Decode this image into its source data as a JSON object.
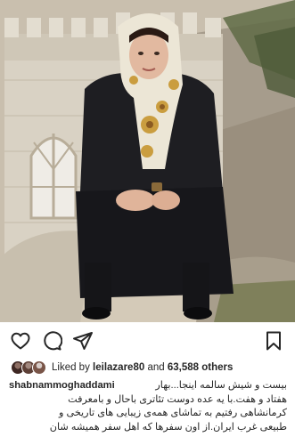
{
  "post": {
    "photo_alt": "",
    "actions": {
      "like_icon": "heart-outline-icon",
      "comment_icon": "comment-bubble-icon",
      "share_icon": "paper-plane-icon",
      "save_icon": "bookmark-outline-icon"
    },
    "likes": {
      "prefix": "Liked by",
      "user": "leilazare80",
      "connector": "and",
      "count": "63,588",
      "suffix": "others"
    },
    "caption": {
      "username": "shabnammoghaddami",
      "lines": [
        "بیست و شیش سالمه اینجا...بهار",
        "هفتاد و هفت.با یه عده دوست تئاتری باحال و بامعرفت",
        "کرمانشاهی رفتیم به تماشای همه‌ی زیبایی های تاریخی و",
        "طبیعی غرب ایران.از اون سفرها که اهل سفر همیشه شان"
      ]
    },
    "colors": {
      "text": "#262626",
      "background": "#ffffff"
    }
  }
}
